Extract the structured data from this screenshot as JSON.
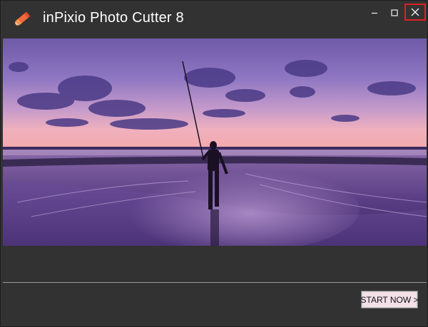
{
  "window": {
    "title": "inPixio Photo Cutter 8",
    "logo_icon": "pencil-logo-icon",
    "controls": {
      "minimize_icon": "minimize-icon",
      "maximize_icon": "maximize-icon",
      "close_icon": "close-icon"
    }
  },
  "main": {
    "hero_image": "sunset-beach-fisherman-photo"
  },
  "footer": {
    "start_label": "START NOW >"
  },
  "colors": {
    "background": "#323232",
    "title_text": "#ffffff",
    "close_highlight": "#e02020",
    "start_button_bg": "#f4e0e8"
  }
}
